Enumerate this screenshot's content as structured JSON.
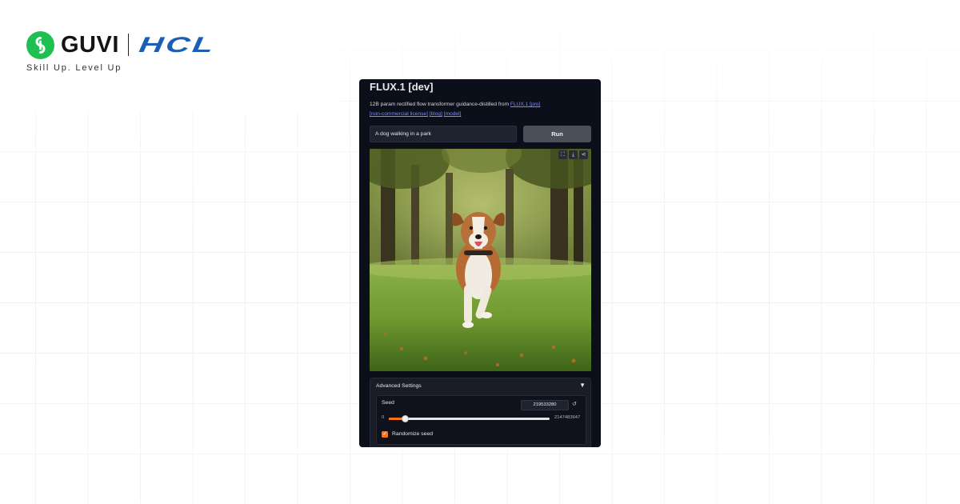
{
  "brand": {
    "name": "GUVI",
    "partner": "HCL",
    "tagline": "Skill Up. Level Up",
    "colors": {
      "guvi_green": "#1fbf52",
      "hcl_blue": "#1a5fb4"
    }
  },
  "app": {
    "title": "FLUX.1 [dev]",
    "description": "12B param rectified flow transformer guidance-distilled from",
    "links": {
      "pro": "FLUX.1 [pro]",
      "license": "[non-commercial license]",
      "blog": "[blog]",
      "model": "[model]"
    },
    "prompt": {
      "value": "A dog walking in a park"
    },
    "run_label": "Run",
    "image_tools": [
      "fullscreen-icon",
      "download-icon",
      "share-icon"
    ],
    "advanced": {
      "label": "Advanced Settings",
      "toggle": "▼",
      "seed": {
        "label": "Seed",
        "value": "219533280",
        "reset_icon": "↺",
        "min": "0",
        "max": "2147483647",
        "slider_fraction": 0.1
      },
      "randomize": {
        "label": "Randomize seed",
        "checked": true
      }
    },
    "colors": {
      "panel_bg": "#0b0f19",
      "accent": "#f97316",
      "link": "#7e8cf5"
    }
  }
}
